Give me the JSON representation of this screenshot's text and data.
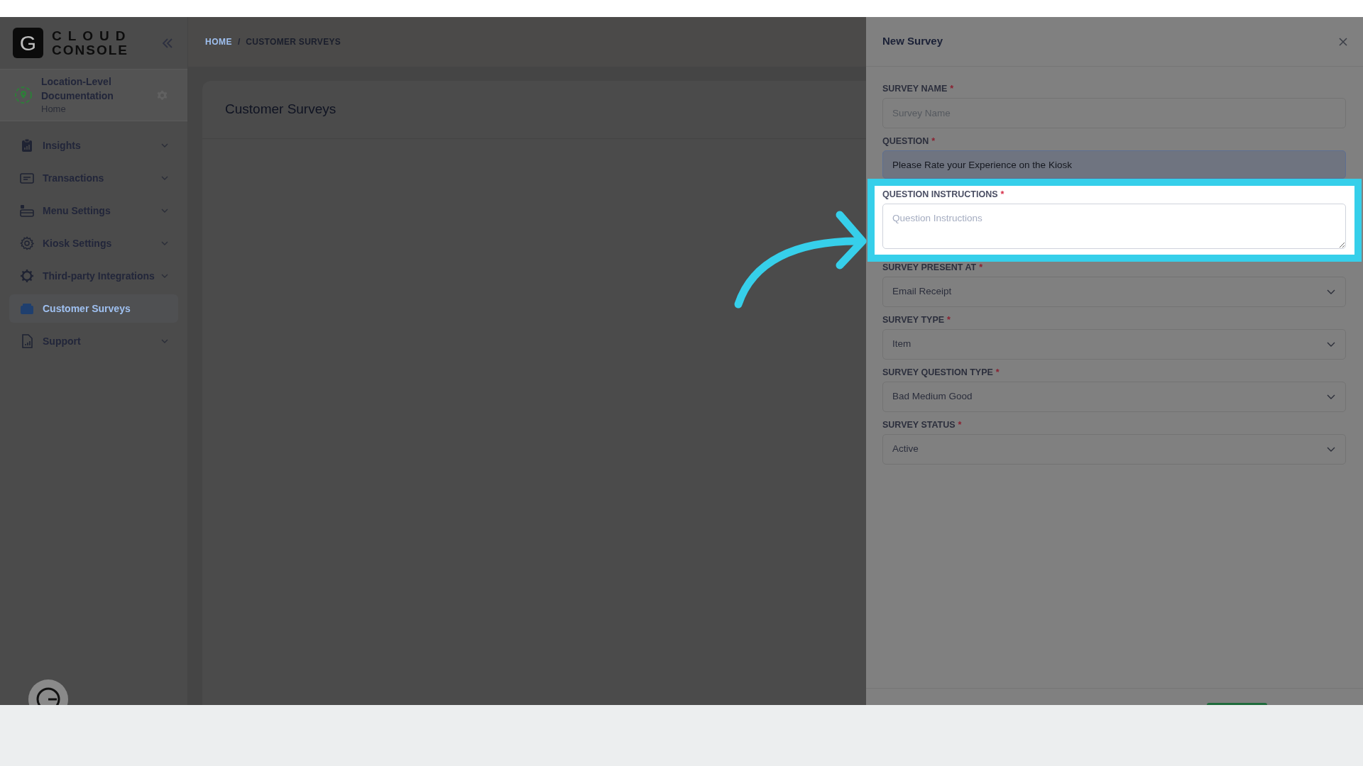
{
  "logo": {
    "mark": "G",
    "line_1": "CLOUD",
    "line_2": "CONSOLE"
  },
  "location": {
    "name": "Location-Level Documentation",
    "subtitle": "Home"
  },
  "nav": [
    {
      "label": "Insights",
      "has_submenu": true,
      "selected": false
    },
    {
      "label": "Transactions",
      "has_submenu": true,
      "selected": false
    },
    {
      "label": "Menu Settings",
      "has_submenu": true,
      "selected": false
    },
    {
      "label": "Kiosk Settings",
      "has_submenu": true,
      "selected": false
    },
    {
      "label": "Third-party Integrations",
      "has_submenu": true,
      "selected": false
    },
    {
      "label": "Customer Surveys",
      "has_submenu": false,
      "selected": true
    },
    {
      "label": "Support",
      "has_submenu": true,
      "selected": false
    }
  ],
  "breadcrumb": {
    "items": [
      {
        "label": "HOME",
        "kind": "link"
      },
      {
        "label": "CUSTOMER SURVEYS",
        "kind": "current"
      }
    ],
    "separator": "/"
  },
  "page_title": "Customer Surveys",
  "panel": {
    "title": "New Survey",
    "required_mark": "*",
    "fields": [
      {
        "label": "SURVEY NAME",
        "required": true,
        "kind": "input",
        "placeholder": "Survey Name",
        "focused": false,
        "highlighted": false
      },
      {
        "label": "QUESTION",
        "required": true,
        "kind": "input",
        "value": "Please Rate your Experience on the Kiosk",
        "focused": true,
        "highlighted": false
      },
      {
        "label": "QUESTION INSTRUCTIONS",
        "required": true,
        "kind": "textarea",
        "placeholder": "Question Instructions",
        "focused": false,
        "highlighted": true
      },
      {
        "label": "SURVEY PRESENT AT",
        "required": true,
        "kind": "select",
        "value": "Email Receipt",
        "focused": false,
        "highlighted": false
      },
      {
        "label": "SURVEY TYPE",
        "required": true,
        "kind": "select",
        "value": "Item",
        "focused": false,
        "highlighted": false
      },
      {
        "label": "SURVEY QUESTION TYPE",
        "required": true,
        "kind": "select",
        "value": "Bad Medium Good",
        "focused": false,
        "highlighted": false
      },
      {
        "label": "SURVEY STATUS",
        "required": true,
        "kind": "select",
        "value": "Active",
        "focused": false,
        "highlighted": false
      }
    ]
  }
}
